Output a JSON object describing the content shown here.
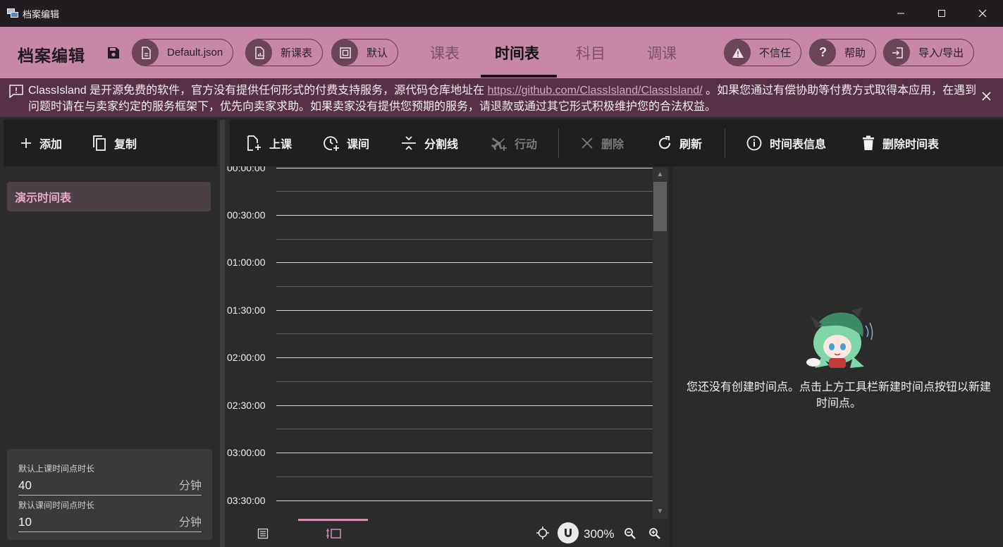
{
  "window": {
    "title": "档案编辑"
  },
  "header": {
    "title": "档案编辑",
    "chips": [
      {
        "label": "Default.json"
      },
      {
        "label": "新课表"
      },
      {
        "label": "默认"
      }
    ],
    "tabs": [
      {
        "label": "课表",
        "active": false
      },
      {
        "label": "时间表",
        "active": true
      },
      {
        "label": "科目",
        "active": false
      },
      {
        "label": "调课",
        "active": false
      }
    ],
    "right_chips": [
      {
        "label": "不信任"
      },
      {
        "label": "帮助"
      },
      {
        "label": "导入/导出"
      }
    ]
  },
  "banner": {
    "text_before": "ClassIsland 是开源免费的软件，官方没有提供任何形式的付费支持服务，源代码仓库地址在 ",
    "link": "https://github.com/ClassIsland/ClassIsland/",
    "text_after": " 。如果您通过有偿协助等付费方式取得本应用，在遇到问题时请在与卖家约定的服务框架下，优先向卖家求助。如果卖家没有提供您预期的服务，请退款或通过其它形式积极维护您的合法权益。"
  },
  "left_toolbar": {
    "add_label": "添加",
    "copy_label": "复制"
  },
  "timetables": [
    {
      "name": "演示时间表"
    }
  ],
  "defaults": {
    "class_duration_label": "默认上课时间点时长",
    "class_duration_value": "40",
    "break_duration_label": "默认课间时间点时长",
    "break_duration_value": "10",
    "unit": "分钟"
  },
  "main_toolbar": {
    "class_label": "上课",
    "break_label": "课间",
    "divider_label": "分割线",
    "action_label": "行动",
    "delete_label": "删除",
    "refresh_label": "刷新",
    "info_label": "时间表信息",
    "delete_table_label": "删除时间表"
  },
  "timeline": {
    "labels": [
      "00:00:00",
      "00:30:00",
      "01:00:00",
      "01:30:00",
      "02:00:00",
      "02:30:00",
      "03:00:00",
      "03:30:00"
    ]
  },
  "zoom": {
    "level": "300%"
  },
  "empty_state": {
    "message": "您还没有创建时间点。点击上方工具栏新建时间点按钮以新建时间点。"
  }
}
